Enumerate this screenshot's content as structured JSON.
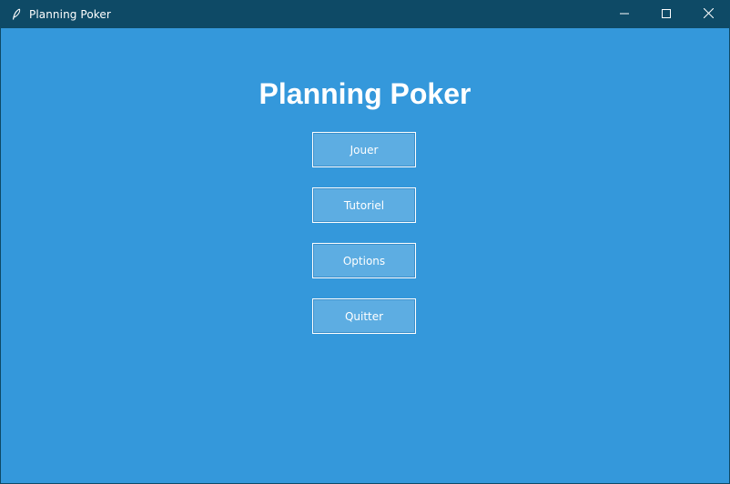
{
  "window": {
    "title": "Planning Poker",
    "app_icon": "feather-icon",
    "controls": [
      "minimize-icon",
      "maximize-icon",
      "close-icon"
    ]
  },
  "main": {
    "heading": "Planning Poker",
    "buttons": [
      {
        "label": "Jouer"
      },
      {
        "label": "Tutoriel"
      },
      {
        "label": "Options"
      },
      {
        "label": "Quitter"
      }
    ]
  },
  "colors": {
    "background": "#3498db",
    "titlebar": "#0e4a66",
    "button": "#5dade2",
    "text": "#ffffff"
  }
}
